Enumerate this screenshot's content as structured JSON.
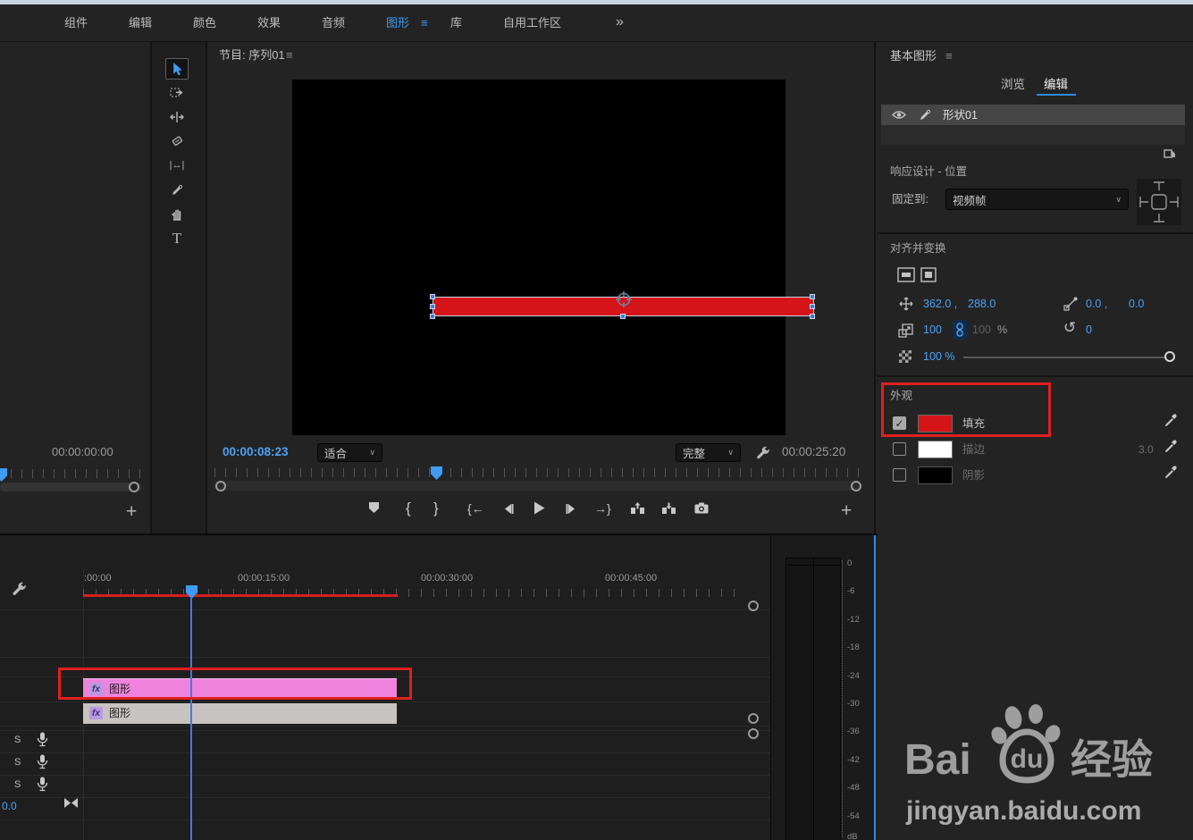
{
  "icons": {
    "hamburger": "≡",
    "overflow": "»",
    "chevron": "∨",
    "plus": "+",
    "check": "✓",
    "mark_in": "{",
    "mark_out": "}",
    "go_to_in": "{←",
    "go_to_out": "→}",
    "slip_tool": "|↔|",
    "type_tool": "T",
    "rotate": "↺",
    "solo": "S"
  },
  "menubar": {
    "items": [
      "组件",
      "编辑",
      "颜色",
      "效果",
      "音频",
      "图形",
      "库",
      "自用工作区"
    ]
  },
  "source_monitor": {
    "timecode": "00:00:00:00"
  },
  "program_monitor": {
    "title": "节目: 序列01",
    "position_timecode": "00:00:08:23",
    "zoom_level": "适合",
    "playback_resolution": "完整",
    "duration_timecode": "00:00:25:20"
  },
  "essential_graphics": {
    "panel_title": "基本图形",
    "tab_browse": "浏览",
    "tab_edit": "编辑",
    "layer_name": "形状01",
    "responsive_section": "响应设计 - 位置",
    "pin_to_label": "固定到:",
    "pin_to_value": "视频帧",
    "transform_section": "对齐并变换",
    "position_x": "362.0 ,",
    "position_y": "288.0",
    "anchor_x": "0.0 ,",
    "anchor_y": "0.0",
    "scale_w": "100",
    "scale_h": "100",
    "scale_unit": "%",
    "rotation": "0",
    "opacity": "100 %",
    "appearance_section": "外观",
    "fill_label": "填充",
    "stroke_label": "描边",
    "stroke_width": "3.0",
    "shadow_label": "阴影"
  },
  "timeline": {
    "ruler_labels": [
      ":00:00",
      "00:00:15:00",
      "00:00:30:00",
      "00:00:45:00"
    ],
    "clips": [
      {
        "fx_badge": "fx",
        "label": "图形"
      },
      {
        "fx_badge": "fx",
        "label": "图形"
      }
    ],
    "master_level": "0.0"
  },
  "audio_meter": {
    "scale": [
      "0",
      "-6",
      "-12",
      "-18",
      "-24",
      "-30",
      "-36",
      "-42",
      "-48",
      "-54"
    ],
    "unit": "dB"
  },
  "watermark": {
    "brand_bai": "Bai",
    "brand_du": "du",
    "brand_suffix": "经验",
    "site_url": "jingyan.baidu.com"
  }
}
